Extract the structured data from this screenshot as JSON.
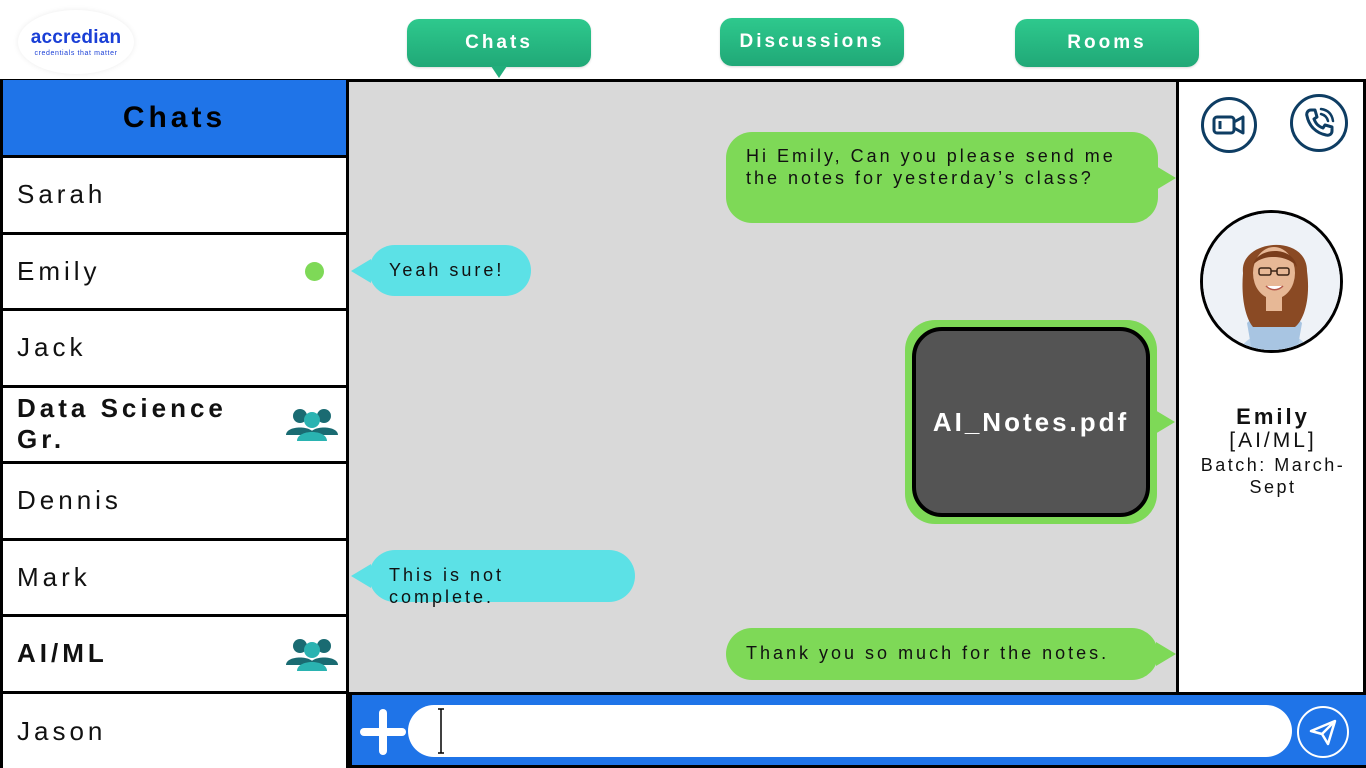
{
  "logo": {
    "name": "accredian",
    "tagline": "credentials that matter"
  },
  "nav": {
    "chats": "Chats",
    "discussions": "Discussions",
    "rooms": "Rooms"
  },
  "sidebar": {
    "title": "Chats",
    "items": [
      {
        "label": "Sarah",
        "group": false,
        "online": false
      },
      {
        "label": "Emily",
        "group": false,
        "online": true
      },
      {
        "label": "Jack",
        "group": false,
        "online": false
      },
      {
        "label": "Data Science Gr.",
        "group": true,
        "online": false
      },
      {
        "label": "Dennis",
        "group": false,
        "online": false
      },
      {
        "label": "Mark",
        "group": false,
        "online": false
      },
      {
        "label": "AI/ML",
        "group": true,
        "online": false
      },
      {
        "label": "Jason",
        "group": false,
        "online": false
      }
    ]
  },
  "messages": {
    "m1": "Hi Emily, Can you please send me the notes for yesterday’s class?",
    "m2": "Yeah sure!",
    "m3": "AI_Notes.pdf",
    "m4": "This is not complete.",
    "m5": "Thank you so much for the notes."
  },
  "profile": {
    "name": "Emily",
    "group": "[AI/ML]",
    "batch": "Batch: March-Sept",
    "icons": {
      "video": "video-call-icon",
      "call": "phone-icon"
    }
  },
  "composer": {
    "value": "",
    "placeholder": ""
  },
  "colors": {
    "accent_blue": "#1f74e8",
    "nav_green": "#22ad7b",
    "outgoing_bubble": "#7ed957",
    "incoming_bubble": "#5ce1e6",
    "chat_bg": "#d9d9d9",
    "online": "#7ed957"
  }
}
